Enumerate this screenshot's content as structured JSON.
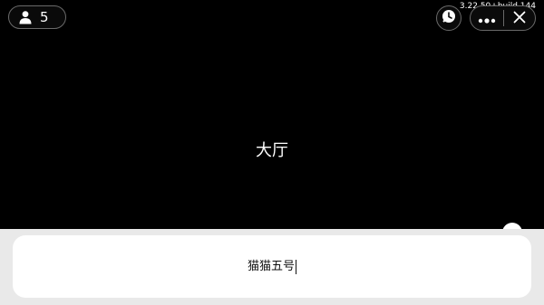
{
  "header": {
    "player_count": "5",
    "version": "3.22.50+build.144",
    "icons": {
      "player": "person-icon",
      "history": "clock-icon",
      "more": "more-dots-icon",
      "close": "close-icon"
    }
  },
  "main": {
    "title": "大厅"
  },
  "input": {
    "value": "猫猫五号"
  },
  "colors": {
    "background": "#000000",
    "panel": "#e9e9e9",
    "input_bg": "#ffffff",
    "text_light": "#ffffff",
    "text_dark": "#111111"
  }
}
